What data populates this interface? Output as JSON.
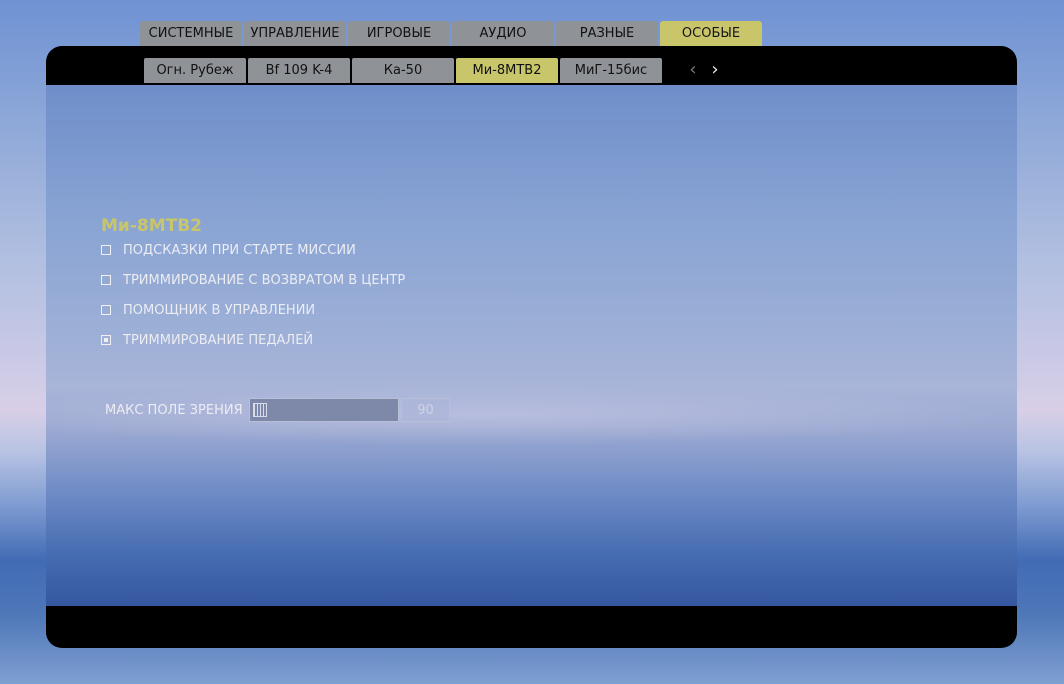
{
  "top_tabs": [
    {
      "label": "СИСТЕМНЫЕ"
    },
    {
      "label": "УПРАВЛЕНИЕ"
    },
    {
      "label": "ИГРОВЫЕ"
    },
    {
      "label": "АУДИО"
    },
    {
      "label": "РАЗНЫЕ"
    },
    {
      "label": "ОСОБЫЕ",
      "active": true
    }
  ],
  "sub_tabs": [
    {
      "label": "Огн. Рубеж"
    },
    {
      "label": "Bf 109 K-4"
    },
    {
      "label": "Ка-50"
    },
    {
      "label": "Ми-8МТВ2",
      "active": true
    },
    {
      "label": "МиГ-15бис"
    }
  ],
  "nav": {
    "prev_icon": "‹",
    "next_icon": "›"
  },
  "section": {
    "title": "Ми-8МТВ2"
  },
  "options": [
    {
      "label": "ПОДСКАЗКИ ПРИ СТАРТЕ МИССИИ",
      "checked": false
    },
    {
      "label": "ТРИММИРОВАНИЕ С ВОЗВРАТОМ В ЦЕНТР",
      "checked": false
    },
    {
      "label": "ПОМОЩНИК В УПРАВЛЕНИИ",
      "checked": false
    },
    {
      "label": "ТРИММИРОВАНИЕ ПЕДАЛЕЙ",
      "checked": true
    }
  ],
  "fov": {
    "label": "МАКС ПОЛЕ ЗРЕНИЯ",
    "value": "90",
    "slider_level": 0
  },
  "colors": {
    "accent": "#c9c56a",
    "tab_inactive": "#8f9297",
    "panel_frame": "#000000"
  }
}
